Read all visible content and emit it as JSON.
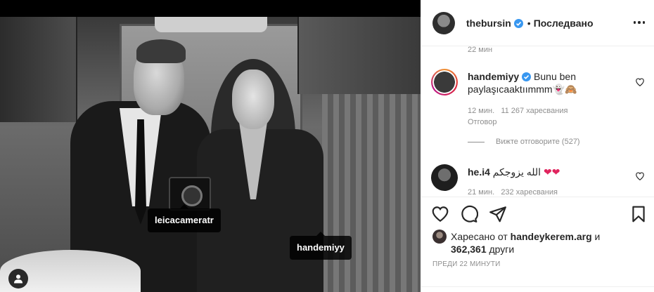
{
  "post": {
    "owner": "thebursin",
    "follow_status": "Последвано",
    "separator": "•",
    "photo_tags": [
      "leicacameratr",
      "handemiyy"
    ]
  },
  "comments": {
    "cutoff_meta": "22 мин",
    "items": [
      {
        "username": "handemiyy",
        "text": "Bunu ben paylaşıcaaktıımmm👻🙈",
        "time": "12 мин.",
        "likes": "11 267 харесвания",
        "reply_label": "Отговор"
      },
      {
        "username": "he.i4",
        "text": "الله يزوجكم",
        "hearts": "❤❤",
        "time": "21 мин.",
        "likes": "232 харесвания"
      }
    ],
    "view_replies": "Вижте отговорите (527)"
  },
  "engagement": {
    "liked_by_prefix": "Харесано от",
    "liked_by_user": "handeykerem.arg",
    "liked_by_and": "и",
    "others_count": "362,361",
    "others_label": "други",
    "posted_ago": "преди 22 минути"
  },
  "colors": {
    "verified": "#3897f0",
    "heart": "#e0245e",
    "text_primary": "#262626",
    "text_secondary": "#8e8e8e"
  },
  "icons": {
    "like": "heart-outline-icon",
    "comment": "speech-bubble-icon",
    "share": "paper-plane-icon",
    "save": "bookmark-icon",
    "more": "ellipsis-icon",
    "tagged_users": "user-icon"
  }
}
